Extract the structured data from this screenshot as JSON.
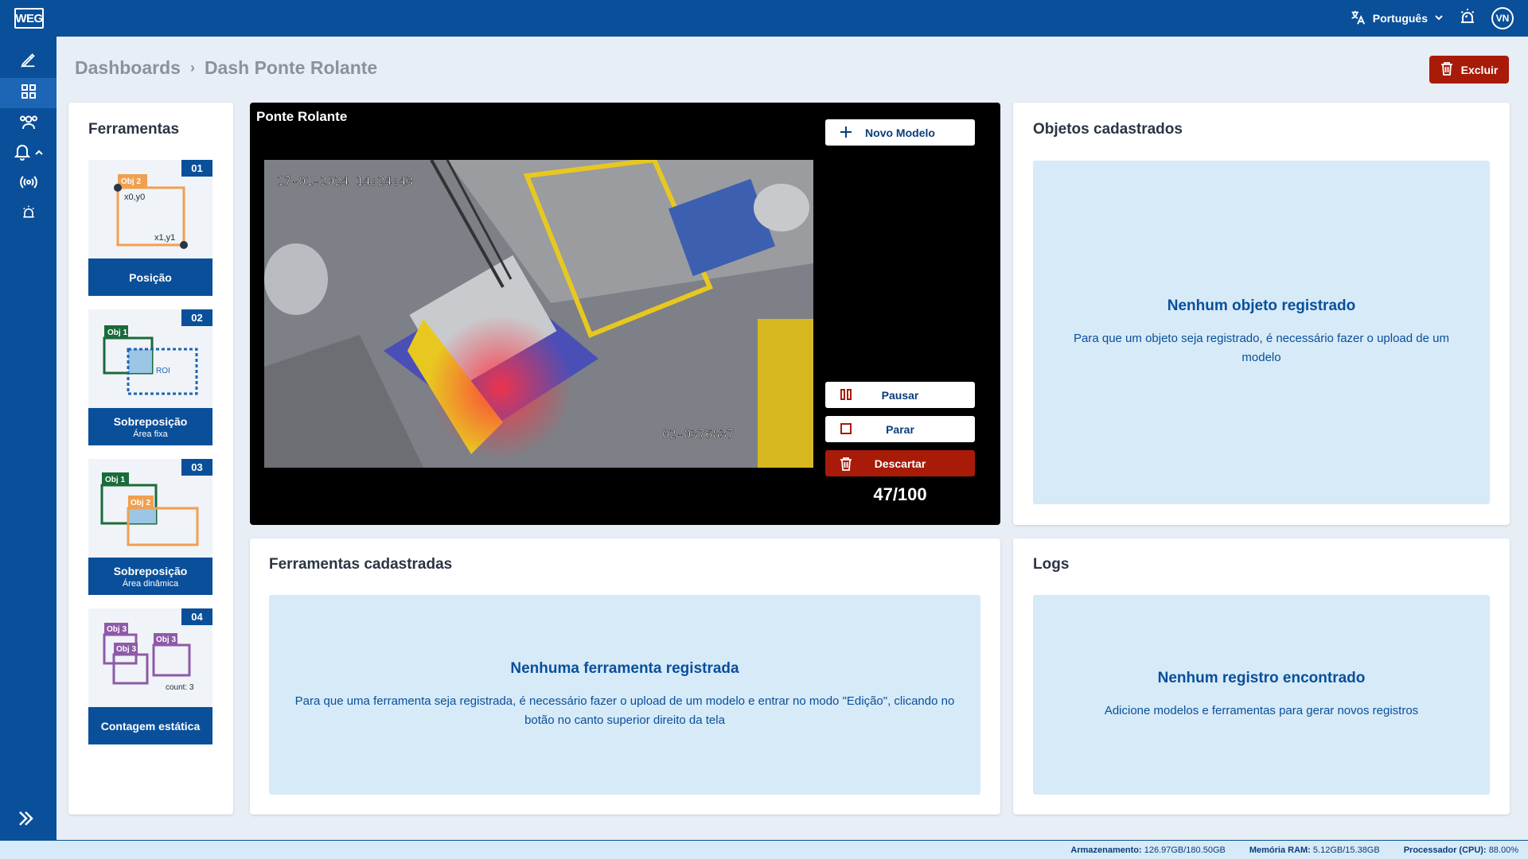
{
  "app": {
    "logo_text": "WEG",
    "language": "Português",
    "user_initials": "VN"
  },
  "breadcrumb": {
    "root": "Dashboards",
    "current": "Dash Ponte Rolante"
  },
  "actions": {
    "delete_label": "Excluir"
  },
  "tools_panel": {
    "title": "Ferramentas",
    "tools": [
      {
        "number": "01",
        "label": "Posição",
        "sublabel": "",
        "diagram": {
          "obj": "Obj 2",
          "p0": "x0,y0",
          "p1": "x1,y1"
        }
      },
      {
        "number": "02",
        "label": "Sobreposição",
        "sublabel": "Área fixa",
        "diagram": {
          "obj": "Obj 1",
          "roi": "ROI"
        }
      },
      {
        "number": "03",
        "label": "Sobreposição",
        "sublabel": "Área dinâmica",
        "diagram": {
          "obj_a": "Obj 1",
          "obj_b": "Obj 2"
        }
      },
      {
        "number": "04",
        "label": "Contagem estática",
        "sublabel": "",
        "diagram": {
          "obj": "Obj 3",
          "count": "count: 3"
        }
      }
    ]
  },
  "video": {
    "title": "Ponte Rolante",
    "new_model_label": "Novo Modelo",
    "pause_label": "Pausar",
    "stop_label": "Parar",
    "discard_label": "Descartar",
    "counter": "47/100",
    "overlay_timestamp": "17-01-2024 14:24:43",
    "overlay_id": "02-0376837"
  },
  "objects_panel": {
    "title": "Objetos cadastrados",
    "empty_title": "Nenhum objeto registrado",
    "empty_desc": "Para que um objeto seja registrado, é necessário fazer o upload de um modelo"
  },
  "registered_tools_panel": {
    "title": "Ferramentas cadastradas",
    "empty_title": "Nenhuma ferramenta registrada",
    "empty_desc": "Para que uma ferramenta seja registrada, é necessário fazer o upload de um modelo e entrar no modo \"Edição\", clicando no botão no canto superior direito da tela"
  },
  "logs_panel": {
    "title": "Logs",
    "empty_title": "Nenhum registro encontrado",
    "empty_desc": "Adicione modelos e ferramentas para gerar novos registros"
  },
  "status": {
    "storage_label": "Armazenamento:",
    "storage_value": "126.97GB/180.50GB",
    "ram_label": "Memória RAM:",
    "ram_value": "5.12GB/15.38GB",
    "cpu_label": "Processador (CPU):",
    "cpu_value": "88.00%"
  },
  "colors": {
    "brand_blue": "#0a4f9a",
    "danger_red": "#a81b08",
    "empty_bg": "#d6eaf8",
    "orange": "#f0a050",
    "green": "#1a6b3a",
    "purple": "#8e5aa8"
  }
}
